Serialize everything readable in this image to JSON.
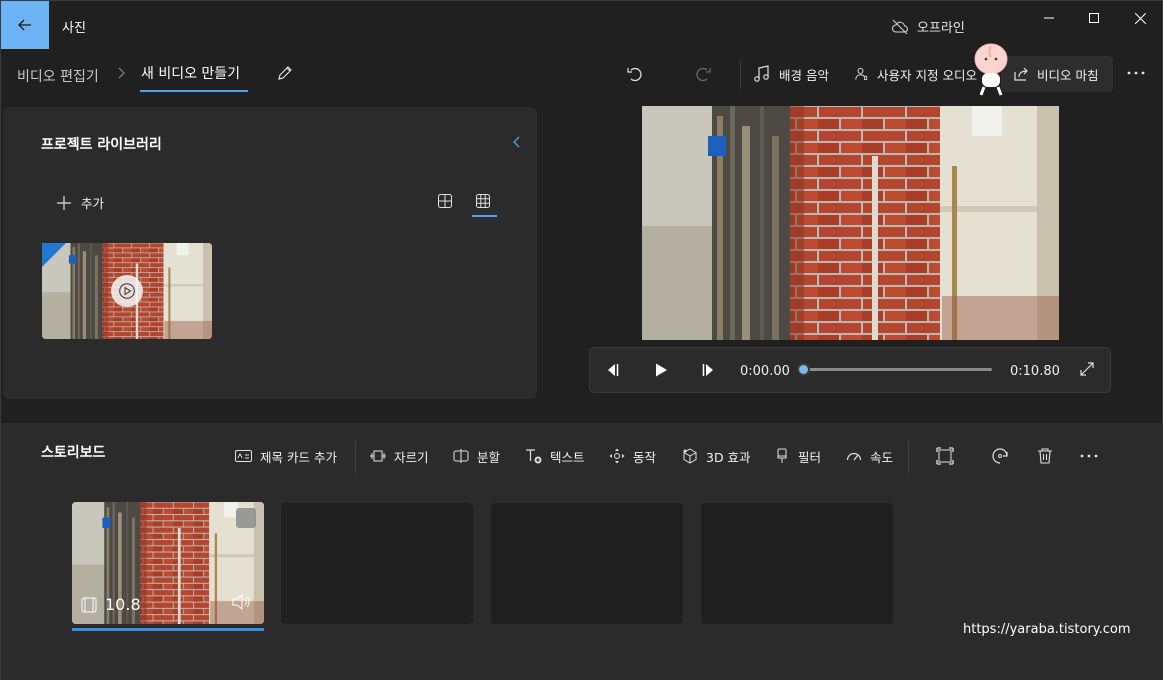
{
  "titlebar": {
    "app_title": "사진",
    "offline_label": "오프라인"
  },
  "command_bar": {
    "breadcrumb_parent": "비디오 편집기",
    "breadcrumb_current": "새 비디오 만들기",
    "background_music_label": "배경 음악",
    "custom_audio_label": "사용자 지정 오디오",
    "finish_video_label": "비디오 마침"
  },
  "library": {
    "title": "프로젝트 라이브러리",
    "add_label": "추가"
  },
  "player": {
    "current_time": "0:00.00",
    "total_time": "0:10.80",
    "progress": 0
  },
  "storyboard": {
    "title": "스토리보드",
    "tools": {
      "title_card": "제목 카드 추가",
      "trim": "자르기",
      "split": "분할",
      "text": "텍스트",
      "motion": "동작",
      "effects_3d": "3D 효과",
      "filters": "필터",
      "speed": "속도"
    },
    "clips": [
      {
        "duration": "10.8"
      }
    ]
  },
  "watermark": "https://yaraba.tistory.com",
  "colors": {
    "accent": "#4ba3ef",
    "back_button": "#6bb3f5",
    "background": "#202020",
    "panel": "#2b2b2b"
  }
}
